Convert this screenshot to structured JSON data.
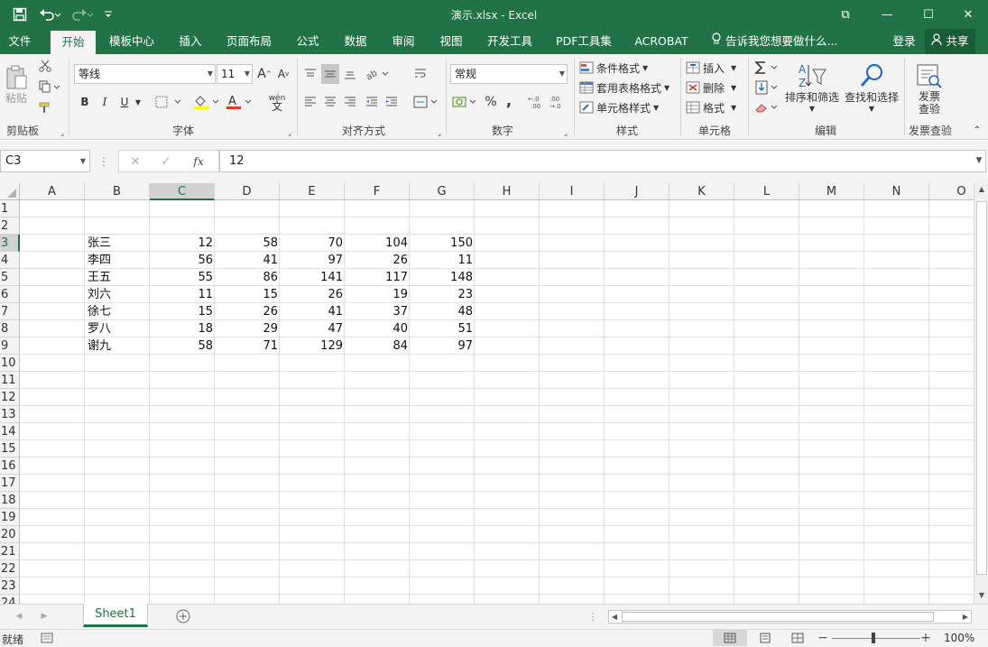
{
  "window": {
    "title": "演示.xlsx - Excel",
    "minimize": "—",
    "restore": "☐",
    "close": "✕",
    "ribbon_display": "⧉"
  },
  "tabs": [
    {
      "label": "文件"
    },
    {
      "label": "开始"
    },
    {
      "label": "模板中心"
    },
    {
      "label": "插入"
    },
    {
      "label": "页面布局"
    },
    {
      "label": "公式"
    },
    {
      "label": "数据"
    },
    {
      "label": "审阅"
    },
    {
      "label": "视图"
    },
    {
      "label": "开发工具"
    },
    {
      "label": "PDF工具集"
    },
    {
      "label": "ACROBAT"
    }
  ],
  "tellme": "告诉我您想要做什么...",
  "login": "登录",
  "share": "共享",
  "ribbon": {
    "clipboard": {
      "paste": "粘贴",
      "label": "剪贴板"
    },
    "font": {
      "name": "等线",
      "size": "11",
      "label": "字体",
      "bold": "B",
      "italic": "I",
      "underline": "U",
      "wen": "wén"
    },
    "align": {
      "label": "对齐方式"
    },
    "number": {
      "format": "常规",
      "label": "数字",
      "percent": "%",
      "comma": ",",
      "inc": "←.0 .00",
      "dec": ".00 →.0"
    },
    "styles": {
      "cond": "条件格式",
      "table": "套用表格格式",
      "cell": "单元格样式",
      "label": "样式"
    },
    "cells": {
      "insert": "插入",
      "delete": "删除",
      "format": "格式",
      "label": "单元格"
    },
    "editing": {
      "sort": "排序和筛选",
      "find": "查找和选择",
      "label": "编辑"
    },
    "invoice": {
      "line1": "发票",
      "line2": "查验",
      "label": "发票查验"
    }
  },
  "formula_bar": {
    "name_box": "C3",
    "cancel": "✕",
    "enter": "✓",
    "fx": "fx",
    "value": "12"
  },
  "columns": [
    "A",
    "B",
    "C",
    "D",
    "E",
    "F",
    "G",
    "H",
    "I",
    "J",
    "K",
    "L",
    "M",
    "N",
    "O"
  ],
  "rows": [
    "1",
    "2",
    "3",
    "4",
    "5",
    "6",
    "7",
    "8",
    "9",
    "10",
    "11",
    "12",
    "13",
    "14",
    "15",
    "16",
    "17",
    "18",
    "19",
    "20",
    "21",
    "22",
    "23",
    "24"
  ],
  "sheet_data": [
    {
      "name": "张三",
      "values": [
        "12",
        "58",
        "70",
        "104",
        "150"
      ]
    },
    {
      "name": "李四",
      "values": [
        "56",
        "41",
        "97",
        "26",
        "11"
      ]
    },
    {
      "name": "王五",
      "values": [
        "55",
        "86",
        "141",
        "117",
        "148"
      ]
    },
    {
      "name": "刘六",
      "values": [
        "11",
        "15",
        "26",
        "19",
        "23"
      ]
    },
    {
      "name": "徐七",
      "values": [
        "15",
        "26",
        "41",
        "37",
        "48"
      ]
    },
    {
      "name": "罗八",
      "values": [
        "18",
        "29",
        "47",
        "40",
        "51"
      ]
    },
    {
      "name": "谢九",
      "values": [
        "58",
        "71",
        "129",
        "84",
        "97"
      ]
    }
  ],
  "sheet_tab": "Sheet1",
  "status": {
    "ready": "就绪",
    "zoom": "100%"
  },
  "colors": {
    "accent": "#217346",
    "ribbon_bg": "#f3f3f3",
    "grid": "#d4d4d4"
  }
}
